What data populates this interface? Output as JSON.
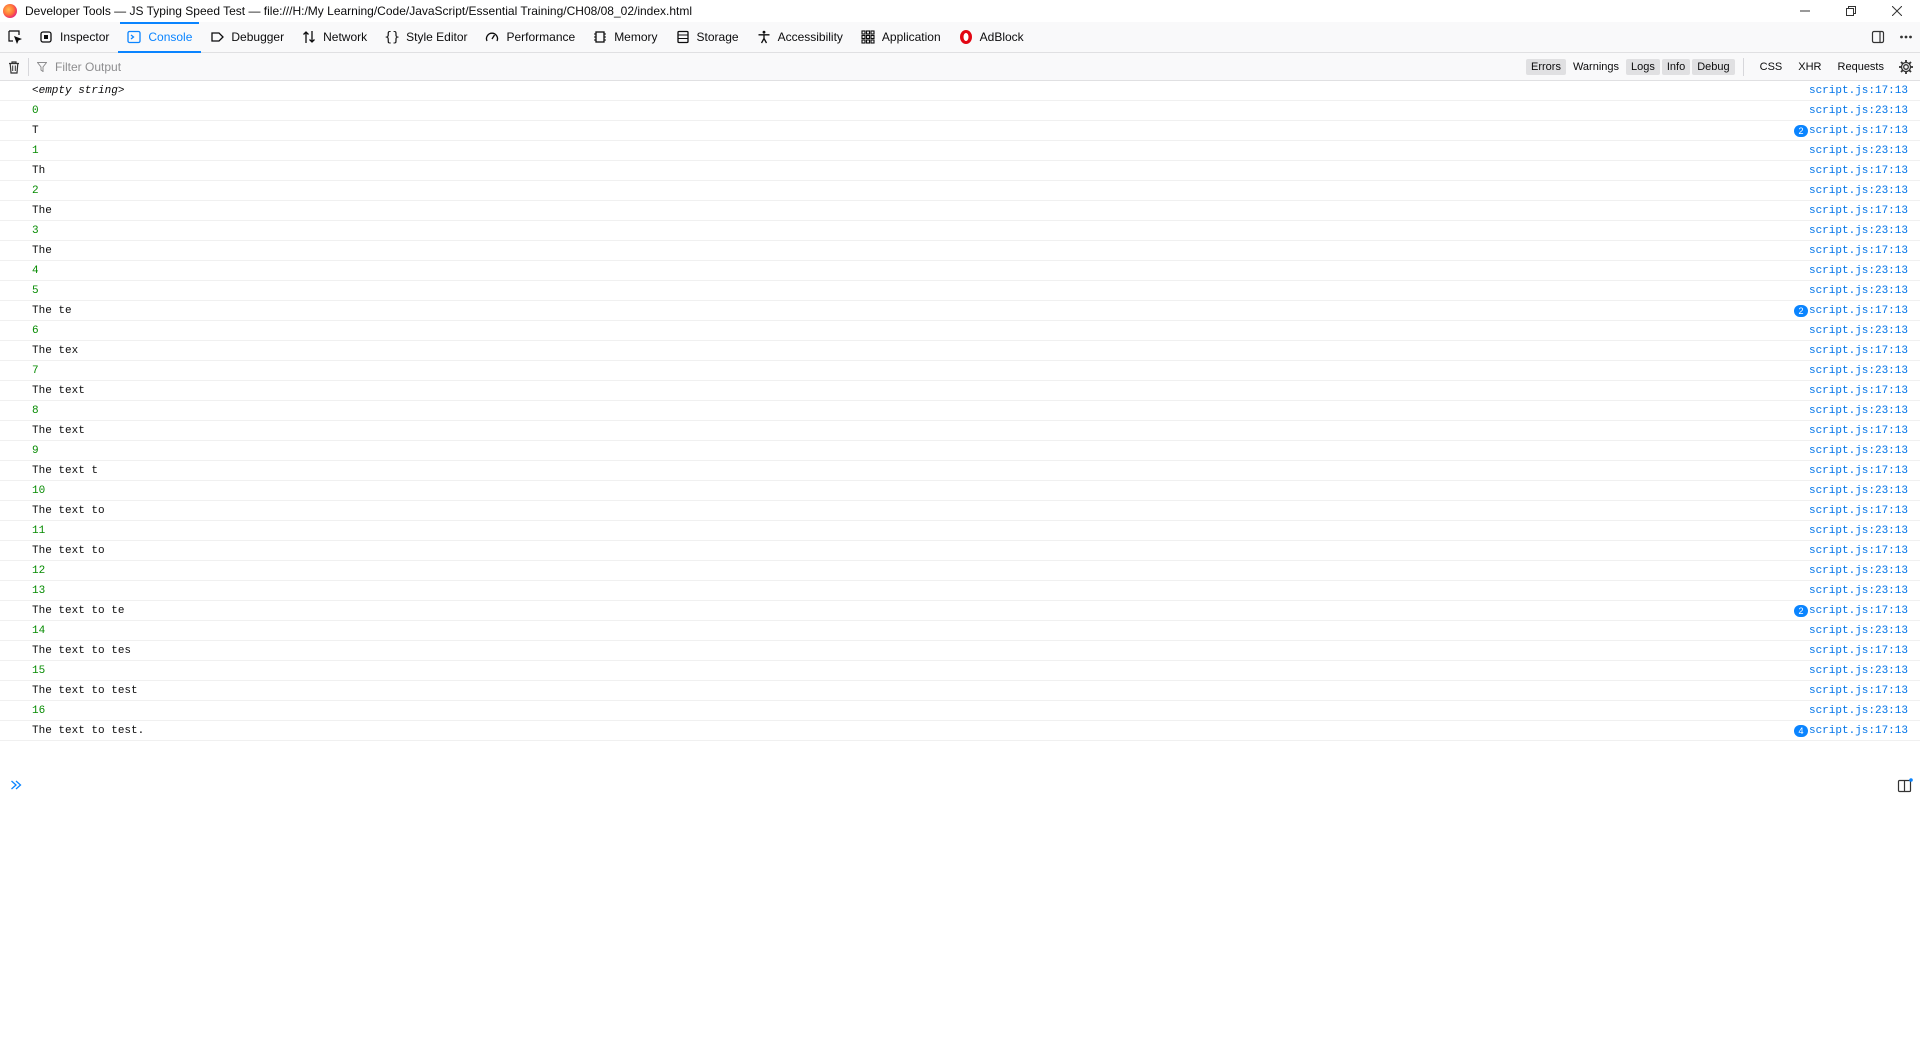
{
  "window": {
    "title": "Developer Tools — JS Typing Speed Test — file:///H:/My Learning/Code/JavaScript/Essential Training/CH08/08_02/index.html"
  },
  "toolbar": {
    "tabs": [
      {
        "label": "Inspector",
        "icon": "inspector-icon"
      },
      {
        "label": "Console",
        "icon": "console-icon",
        "selected": true
      },
      {
        "label": "Debugger",
        "icon": "debugger-icon"
      },
      {
        "label": "Network",
        "icon": "network-icon"
      },
      {
        "label": "Style Editor",
        "icon": "style-editor-icon"
      },
      {
        "label": "Performance",
        "icon": "performance-icon"
      },
      {
        "label": "Memory",
        "icon": "memory-icon"
      },
      {
        "label": "Storage",
        "icon": "storage-icon"
      },
      {
        "label": "Accessibility",
        "icon": "accessibility-icon"
      },
      {
        "label": "Application",
        "icon": "application-icon"
      },
      {
        "label": "AdBlock",
        "icon": "adblock-icon"
      }
    ]
  },
  "filter": {
    "placeholder": "Filter Output",
    "levels": [
      "Errors",
      "Warnings",
      "Logs",
      "Info",
      "Debug"
    ],
    "levels_on": [
      "Logs",
      "Info",
      "Debug"
    ],
    "types": [
      "CSS",
      "XHR",
      "Requests"
    ]
  },
  "colors": {
    "accent": "#0a84ff",
    "number_text": "#058b00",
    "link": "#0074e8"
  },
  "console": {
    "rows": [
      {
        "text": "<empty string>",
        "kind": "empty",
        "location": "script.js:17:13"
      },
      {
        "text": "0",
        "kind": "num",
        "location": "script.js:23:13"
      },
      {
        "text": "T",
        "kind": "str",
        "repeat": "2",
        "location": "script.js:17:13"
      },
      {
        "text": "1",
        "kind": "num",
        "location": "script.js:23:13"
      },
      {
        "text": "Th",
        "kind": "str",
        "location": "script.js:17:13"
      },
      {
        "text": "2",
        "kind": "num",
        "location": "script.js:23:13"
      },
      {
        "text": "The",
        "kind": "str",
        "location": "script.js:17:13"
      },
      {
        "text": "3",
        "kind": "num",
        "location": "script.js:23:13"
      },
      {
        "text": "The",
        "kind": "str",
        "location": "script.js:17:13"
      },
      {
        "text": "4",
        "kind": "num",
        "location": "script.js:23:13"
      },
      {
        "text": "5",
        "kind": "num",
        "location": "script.js:23:13"
      },
      {
        "text": "The te",
        "kind": "str",
        "repeat": "2",
        "location": "script.js:17:13"
      },
      {
        "text": "6",
        "kind": "num",
        "location": "script.js:23:13"
      },
      {
        "text": "The tex",
        "kind": "str",
        "location": "script.js:17:13"
      },
      {
        "text": "7",
        "kind": "num",
        "location": "script.js:23:13"
      },
      {
        "text": "The text",
        "kind": "str",
        "location": "script.js:17:13"
      },
      {
        "text": "8",
        "kind": "num",
        "location": "script.js:23:13"
      },
      {
        "text": "The text",
        "kind": "str",
        "location": "script.js:17:13"
      },
      {
        "text": "9",
        "kind": "num",
        "location": "script.js:23:13"
      },
      {
        "text": "The text t",
        "kind": "str",
        "location": "script.js:17:13"
      },
      {
        "text": "10",
        "kind": "num",
        "location": "script.js:23:13"
      },
      {
        "text": "The text to",
        "kind": "str",
        "location": "script.js:17:13"
      },
      {
        "text": "11",
        "kind": "num",
        "location": "script.js:23:13"
      },
      {
        "text": "The text to",
        "kind": "str",
        "location": "script.js:17:13"
      },
      {
        "text": "12",
        "kind": "num",
        "location": "script.js:23:13"
      },
      {
        "text": "13",
        "kind": "num",
        "location": "script.js:23:13"
      },
      {
        "text": "The text to te",
        "kind": "str",
        "repeat": "2",
        "location": "script.js:17:13"
      },
      {
        "text": "14",
        "kind": "num",
        "location": "script.js:23:13"
      },
      {
        "text": "The text to tes",
        "kind": "str",
        "location": "script.js:17:13"
      },
      {
        "text": "15",
        "kind": "num",
        "location": "script.js:23:13"
      },
      {
        "text": "The text to test",
        "kind": "str",
        "location": "script.js:17:13"
      },
      {
        "text": "16",
        "kind": "num",
        "location": "script.js:23:13"
      },
      {
        "text": "The text to test.",
        "kind": "str",
        "repeat": "4",
        "location": "script.js:17:13"
      }
    ]
  }
}
